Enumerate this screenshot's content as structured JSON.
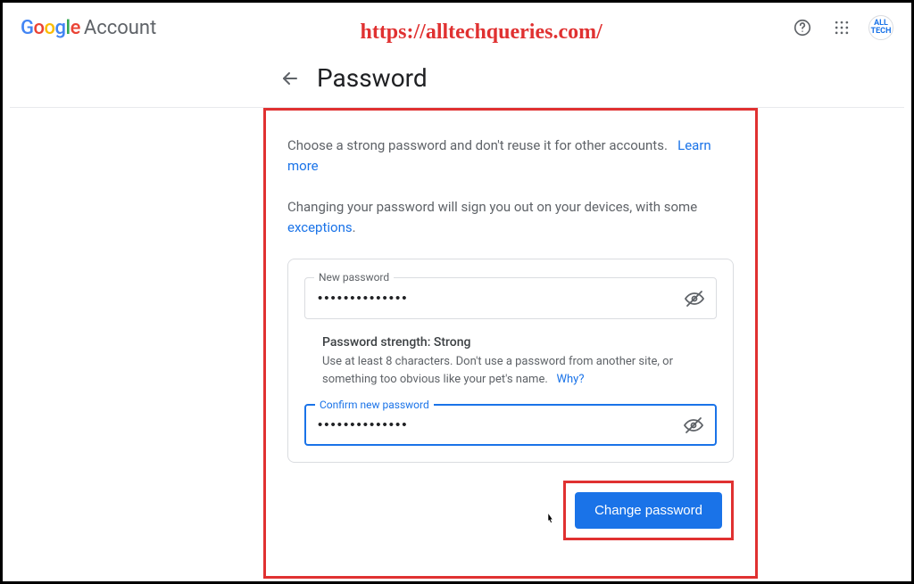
{
  "header": {
    "logo_text": "Google",
    "account_label": "Account",
    "avatar_text": "ALL TECH"
  },
  "watermark_url": "https://alltechqueries.com/",
  "page": {
    "title": "Password"
  },
  "intro": {
    "line1": "Choose a strong password and don't reuse it for other accounts.",
    "learn_more": "Learn more",
    "line2a": "Changing your password will sign you out on your devices, with some ",
    "exceptions": "exceptions",
    "period": "."
  },
  "fields": {
    "new_password": {
      "label": "New password",
      "value": "••••••••••••••"
    },
    "confirm_password": {
      "label": "Confirm new password",
      "value": "••••••••••••••"
    }
  },
  "strength": {
    "title": "Password strength: Strong",
    "msg": "Use at least 8 characters. Don't use a password from another site, or something too obvious like your pet's name.",
    "why": "Why?"
  },
  "action": {
    "button_label": "Change password"
  }
}
